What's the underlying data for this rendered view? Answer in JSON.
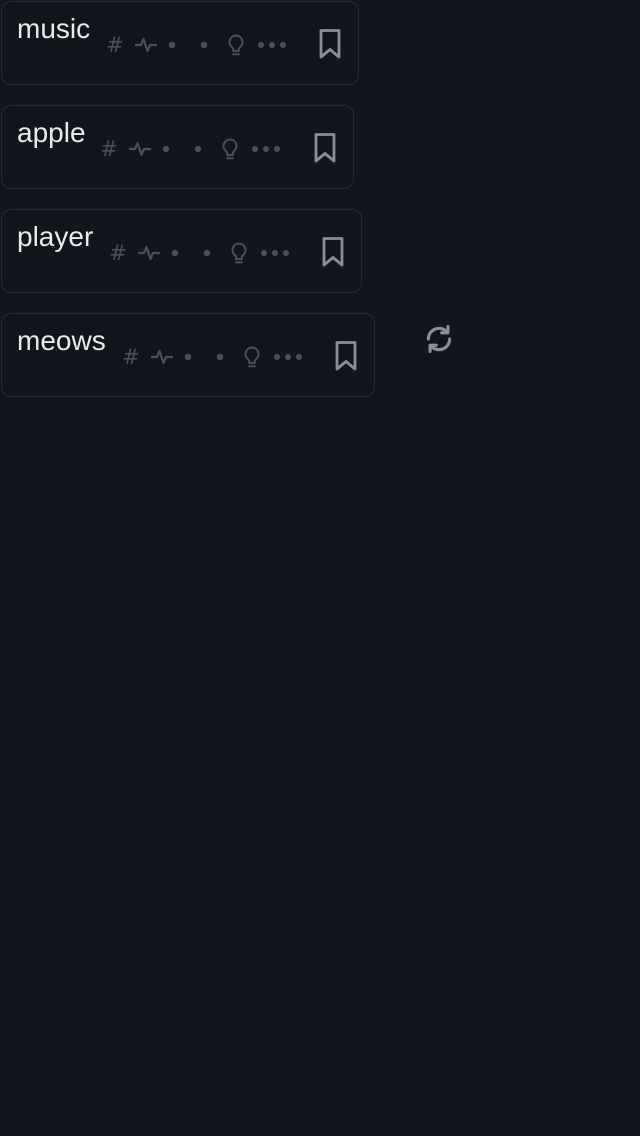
{
  "items": [
    {
      "label": "music",
      "hash_glyph": "#"
    },
    {
      "label": "apple",
      "hash_glyph": "#"
    },
    {
      "label": "player",
      "hash_glyph": "#"
    },
    {
      "label": "meows",
      "hash_glyph": "#"
    }
  ],
  "icons": {
    "hash": "hash-icon",
    "activity": "activity-pulse-icon",
    "dot": "dot-icon",
    "idea": "lightbulb-icon",
    "more": "more-horizontal-icon",
    "bookmark": "bookmark-icon",
    "refresh": "refresh-icon"
  },
  "colors": {
    "background": "#12151b",
    "card_border": "#262a31",
    "label_text": "#e9eaec",
    "muted_icon": "#4b4f57",
    "bookmark_icon": "#8a8e95",
    "refresh_icon": "#8a8e95"
  }
}
